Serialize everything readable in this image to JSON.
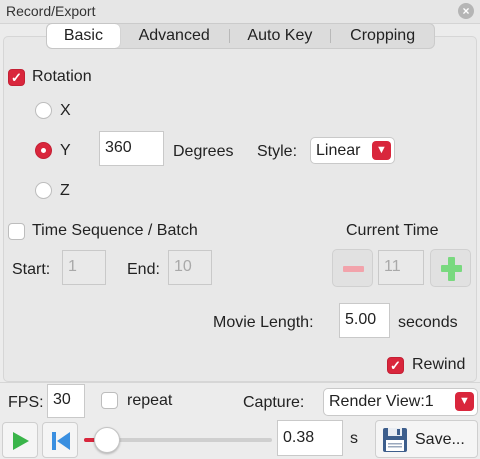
{
  "window": {
    "title": "Record/Export",
    "close_icon": "close-icon"
  },
  "tabs": [
    {
      "label": "Basic",
      "active": true
    },
    {
      "label": "Advanced",
      "active": false
    },
    {
      "label": "Auto Key",
      "active": false
    },
    {
      "label": "Cropping",
      "active": false
    }
  ],
  "rotation": {
    "label": "Rotation",
    "checked": true,
    "axes": [
      {
        "label": "X",
        "selected": false
      },
      {
        "label": "Y",
        "selected": true
      },
      {
        "label": "Z",
        "selected": false
      }
    ],
    "degrees_value": "360",
    "degrees_label": "Degrees",
    "style_label": "Style:",
    "style_value": "Linear"
  },
  "time_sequence": {
    "label": "Time Sequence / Batch",
    "checked": false,
    "start_label": "Start:",
    "start_value": "1",
    "end_label": "End:",
    "end_value": "10",
    "current_time_label": "Current Time",
    "current_time_value": "11",
    "minus_icon": "minus-icon",
    "plus_icon": "plus-icon"
  },
  "movie_length": {
    "label": "Movie Length:",
    "value": "5.00",
    "unit": "seconds"
  },
  "rewind": {
    "label": "Rewind",
    "checked": true
  },
  "fps": {
    "label": "FPS:",
    "value": "30"
  },
  "repeat": {
    "label": "repeat",
    "checked": false
  },
  "capture": {
    "label": "Capture:",
    "value": "Render View:1"
  },
  "playback": {
    "play_icon": "play-icon",
    "skip_back_icon": "skip-to-start-icon",
    "slider_fraction": 0.12,
    "time_value": "0.38",
    "time_unit": "s",
    "save_label": "Save...",
    "save_icon": "floppy-disk-icon"
  },
  "colors": {
    "accent": "#d9263c",
    "play": "#3ab54a",
    "skip": "#3a8fe0",
    "plus": "#79d97f",
    "minus": "#f2a3ab"
  }
}
